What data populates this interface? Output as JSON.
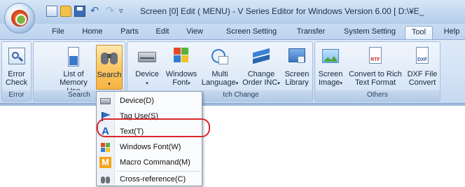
{
  "window": {
    "title": "Screen [0] Edit (        MENU) - V Series Editor for Windows Version 6.00 [ D:\\¥E_"
  },
  "qat": {
    "customize_glyph": "▿"
  },
  "tabs": [
    {
      "label": "File"
    },
    {
      "label": "Home"
    },
    {
      "label": "Parts"
    },
    {
      "label": "Edit"
    },
    {
      "label": "View"
    },
    {
      "label": "Screen Setting"
    },
    {
      "label": "Transfer"
    },
    {
      "label": "System Setting"
    },
    {
      "label": "Tool",
      "active": true
    },
    {
      "label": "Help"
    }
  ],
  "ribbon": {
    "groups": [
      {
        "label": "Error",
        "buttons": [
          {
            "label": "Error\nCheck",
            "icon": "error-check-icon"
          }
        ]
      },
      {
        "label": "Search",
        "buttons": [
          {
            "label": "List of\nMemory Use",
            "icon": "memory-use-icon"
          },
          {
            "label": "Search",
            "icon": "binoculars-icon",
            "dropdown": true,
            "selected": true
          }
        ]
      },
      {
        "label": "Batch Change",
        "visible_label": "tch Change",
        "buttons": [
          {
            "label": "Device",
            "icon": "device-icon",
            "dropdown": true
          },
          {
            "label": "Windows\nFont",
            "icon": "windows-font-icon",
            "dropdown": true
          },
          {
            "label": "Multi\nLanguage",
            "icon": "multi-language-icon",
            "dropdown": true
          },
          {
            "label": "Change\nOrder INC",
            "icon": "change-order-icon",
            "dropdown": true
          },
          {
            "label": "Screen\nLibrary",
            "icon": "screen-library-icon"
          }
        ]
      },
      {
        "label": "Others",
        "buttons": [
          {
            "label": "Screen\nImage",
            "icon": "screen-image-icon",
            "dropdown": true
          },
          {
            "label": "Convert to Rich\nText Format",
            "icon": "rtf-icon"
          },
          {
            "label": "DXF File\nConvert",
            "icon": "dxf-icon"
          }
        ]
      }
    ],
    "icon_text": {
      "rtf": "RTF",
      "dxf": "DXF"
    },
    "dropdown_arrow": "▾"
  },
  "search_menu": {
    "items": [
      {
        "label": "Device(D)",
        "icon": "device-icon"
      },
      {
        "label": "Tag Use(S)",
        "icon": "flag-icon"
      },
      {
        "label": "Text(T)",
        "icon": "text-a-icon",
        "highlighted": true
      },
      {
        "label": "Windows Font(W)",
        "icon": "windows-font-icon"
      },
      {
        "label": "Macro Command(M)",
        "icon": "macro-m-icon"
      },
      {
        "label": "Cross-reference(C)",
        "icon": "binoculars-icon"
      }
    ],
    "glyphs": {
      "text_icon": "A",
      "macro_icon": "M"
    }
  },
  "colors": {
    "ribbon_bg": "#d2e2f5",
    "selected_button": "#f9c866",
    "highlight_ring": "#d9262c"
  }
}
